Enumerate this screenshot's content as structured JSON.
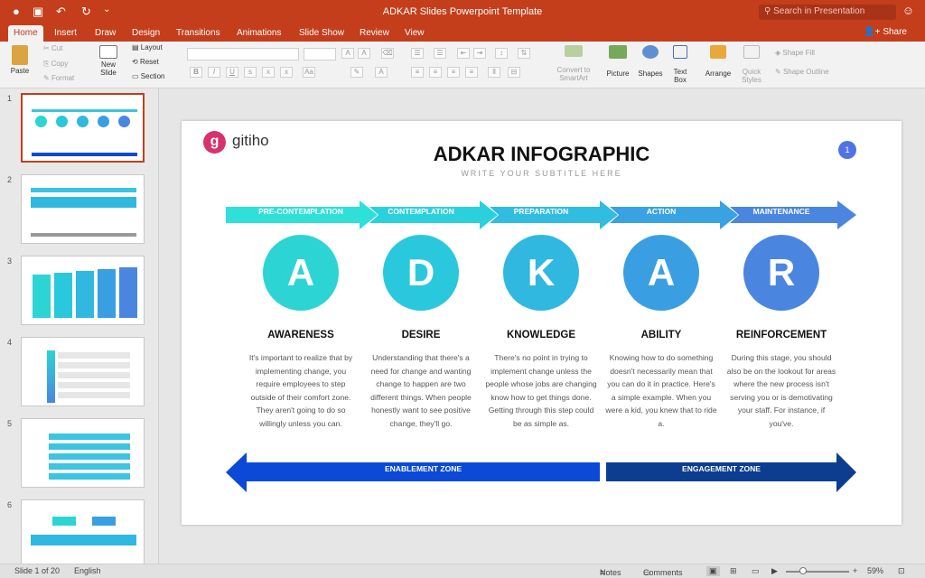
{
  "window": {
    "title": "ADKAR Slides Powerpoint Template",
    "search_placeholder": "Search in Presentation"
  },
  "tabs": [
    "Home",
    "Insert",
    "Draw",
    "Design",
    "Transitions",
    "Animations",
    "Slide Show",
    "Review",
    "View"
  ],
  "share_label": "Share",
  "ribbon": {
    "paste": "Paste",
    "cut": "Cut",
    "copy": "Copy",
    "format": "Format",
    "new_slide": "New\nSlide",
    "layout": "Layout",
    "reset": "Reset",
    "section": "Section",
    "convert": "Convert to\nSmartArt",
    "picture": "Picture",
    "shapes": "Shapes",
    "textbox": "Text\nBox",
    "arrange": "Arrange",
    "quick_styles": "Quick\nStyles",
    "shape_fill": "Shape Fill",
    "shape_outline": "Shape Outline"
  },
  "thumbnails": [
    "1",
    "2",
    "3",
    "4",
    "5",
    "6"
  ],
  "slide": {
    "logo_text": "gitiho",
    "title": "ADKAR INFOGRAPHIC",
    "subtitle": "WRITE YOUR SUBTITLE HERE",
    "page_number": "1",
    "stages": [
      "PRE-CONTEMPLATION",
      "CONTEMPLATION",
      "PREPARATION",
      "ACTION",
      "MAINTENANCE"
    ],
    "columns": [
      {
        "letter": "A",
        "heading": "AWARENESS",
        "color": "#2dd4d4",
        "text": "It's important to realize that by implementing change, you require employees to step outside of their comfort zone. They aren't going to do so willingly unless you can."
      },
      {
        "letter": "D",
        "heading": "DESIRE",
        "color": "#2ac8dc",
        "text": "Understanding that there's a need for change and wanting change to happen are two different things. When people honestly want to see positive change, they'll go."
      },
      {
        "letter": "K",
        "heading": "KNOWLEDGE",
        "color": "#30b8e0",
        "text": "There's no point in trying to implement change unless the people whose jobs are changing know how to get things done. Getting through this step could be as simple as."
      },
      {
        "letter": "A",
        "heading": "ABILITY",
        "color": "#3a9fe2",
        "text": "Knowing how to do something doesn't necessarily mean that you can do it in practice. Here's a simple example. When you were a kid, you knew that to ride a."
      },
      {
        "letter": "R",
        "heading": "REINFORCEMENT",
        "color": "#4a86e0",
        "text": "During this stage, you should also be on the lookout for areas where the new process isn't serving you or is demotivating your staff. For instance, if you've."
      }
    ],
    "zones": [
      "ENABLEMENT ZONE",
      "ENGAGEMENT ZONE"
    ]
  },
  "status": {
    "slide": "Slide 1 of 20",
    "language": "English",
    "notes": "Notes",
    "comments": "Comments",
    "zoom": "59%"
  },
  "colors": {
    "accent": "#c43e1c",
    "enablement": "#0b49d6",
    "engagement": "#0c3d8f"
  }
}
